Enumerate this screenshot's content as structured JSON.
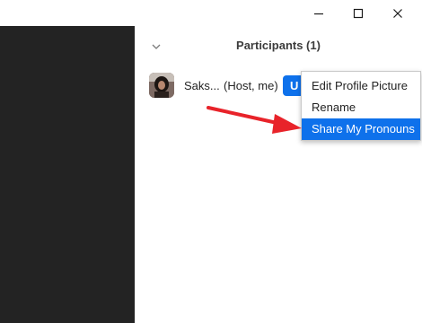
{
  "window": {
    "controls": [
      "minimize-icon",
      "maximize-icon",
      "close-icon"
    ]
  },
  "participants_panel": {
    "title": "Participants (1)",
    "collapse_icon": "chevron-down-icon",
    "participant": {
      "name": "Saks...",
      "role": "(Host, me)",
      "action_label": "U"
    }
  },
  "context_menu": {
    "items": [
      {
        "label": "Edit Profile Picture"
      },
      {
        "label": "Rename"
      },
      {
        "label": "Share My Pronouns",
        "selected": true
      }
    ]
  },
  "colors": {
    "accent": "#0e71eb",
    "dark_pane": "#232323",
    "annotation_arrow": "#e8232a"
  }
}
